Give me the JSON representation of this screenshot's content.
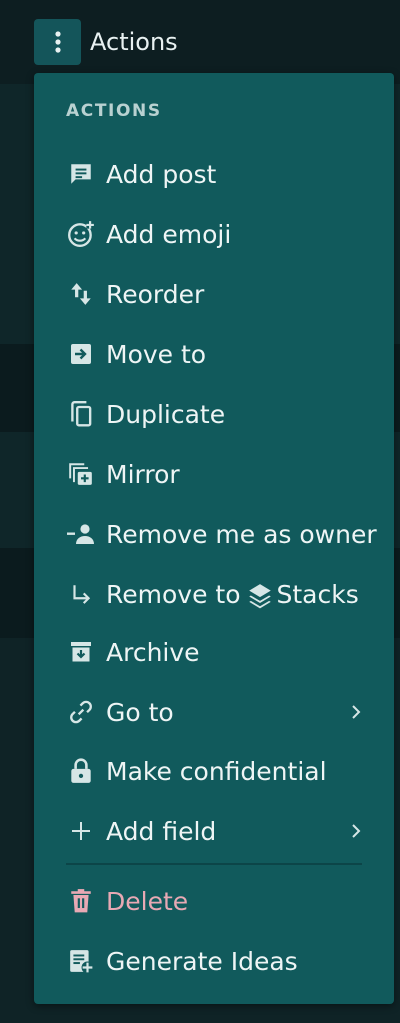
{
  "header": {
    "title": "Actions",
    "menu_icon": "vertical-dots-icon"
  },
  "menu": {
    "section_label": "ACTIONS",
    "items": [
      {
        "label": "Add post",
        "icon": "post-icon"
      },
      {
        "label": "Add emoji",
        "icon": "emoji-add-icon"
      },
      {
        "label": "Reorder",
        "icon": "reorder-icon"
      },
      {
        "label": "Move to",
        "icon": "move-icon"
      },
      {
        "label": "Duplicate",
        "icon": "duplicate-icon"
      },
      {
        "label": "Mirror",
        "icon": "mirror-icon"
      },
      {
        "label": "Remove me as owner",
        "icon": "remove-owner-icon"
      },
      {
        "label_prefix": "Remove to",
        "label_suffix": "Stacks",
        "icon": "return-arrow-icon",
        "inline_icon": "stacks-icon"
      },
      {
        "label": "Archive",
        "icon": "archive-icon"
      },
      {
        "label": "Go to",
        "icon": "link-icon",
        "submenu": true
      },
      {
        "label": "Make confidential",
        "icon": "lock-icon"
      },
      {
        "label": "Add field",
        "icon": "plus-icon",
        "submenu": true
      },
      {
        "label": "Delete",
        "icon": "trash-icon"
      },
      {
        "label": "Generate Ideas",
        "icon": "generate-icon"
      }
    ]
  },
  "colors": {
    "menu_bg": "#115a5c",
    "text": "#eef5f5",
    "danger_text": "#e8a9b4",
    "section_text": "#b9d1d1"
  }
}
